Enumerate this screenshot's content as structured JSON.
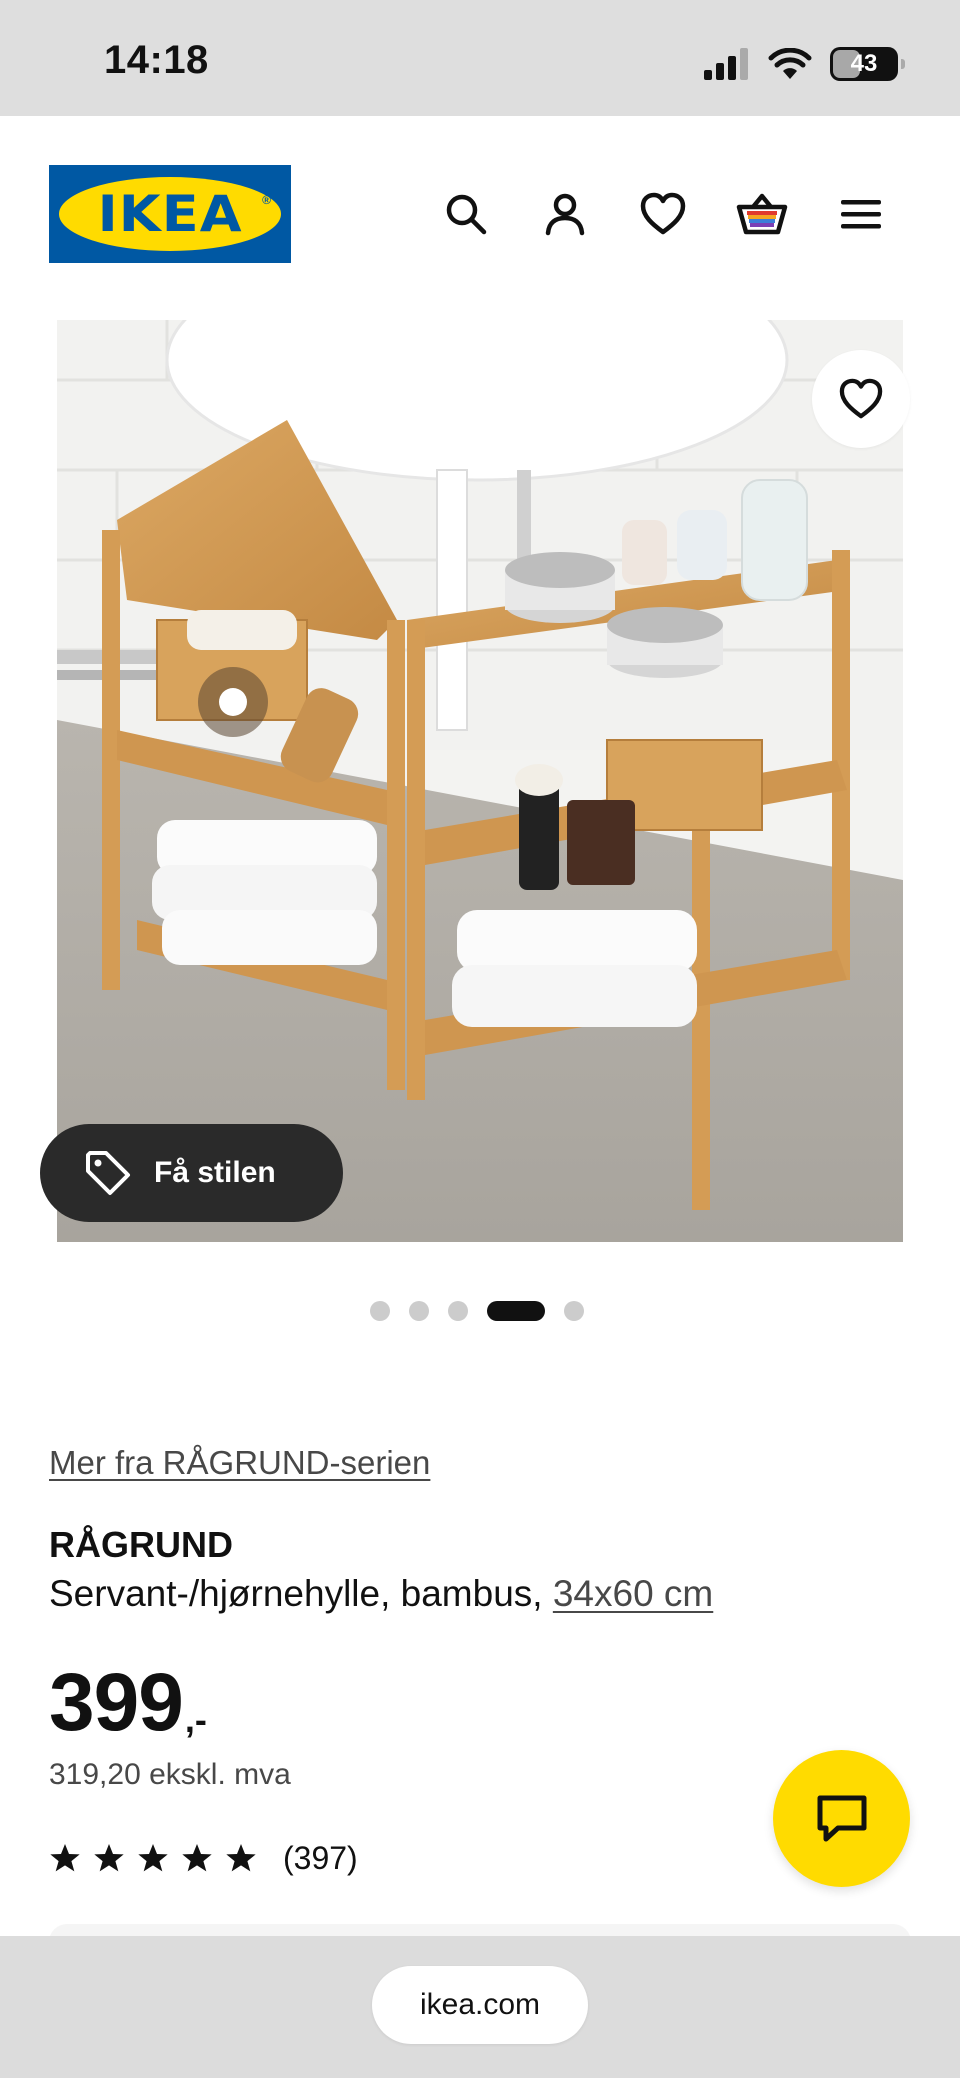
{
  "status_bar": {
    "time": "14:18",
    "battery": "43",
    "battery_level": 0.43,
    "icons": [
      "cellular-signal-icon",
      "wifi-icon",
      "battery-icon"
    ]
  },
  "header": {
    "logo_text": "IKEA",
    "icons": [
      "search-icon",
      "user-icon",
      "heart-icon",
      "cart-icon",
      "menu-icon"
    ]
  },
  "gallery": {
    "style_button_label": "Få stilen",
    "slide_count": 5,
    "active_slide": 4
  },
  "product": {
    "series_link": "Mer fra RÅGRUND-serien",
    "name": "RÅGRUND",
    "description": "Servant-/hjørnehylle, bambus, ",
    "size_link": "34x60 cm",
    "price": "399",
    "price_suffix": ",-",
    "price_ex_vat": "319,20 ekskl. mva",
    "rating_stars": 5,
    "rating_count": "(397)"
  },
  "browser": {
    "url": "ikea.com"
  },
  "colors": {
    "ikea_blue": "#0058a3",
    "ikea_yellow": "#ffdb00",
    "status_bar_bg": "#dedede",
    "dark_pill": "#2a2a2a",
    "text": "#111111",
    "muted_text": "#484848",
    "dot_inactive": "#cccccc"
  }
}
